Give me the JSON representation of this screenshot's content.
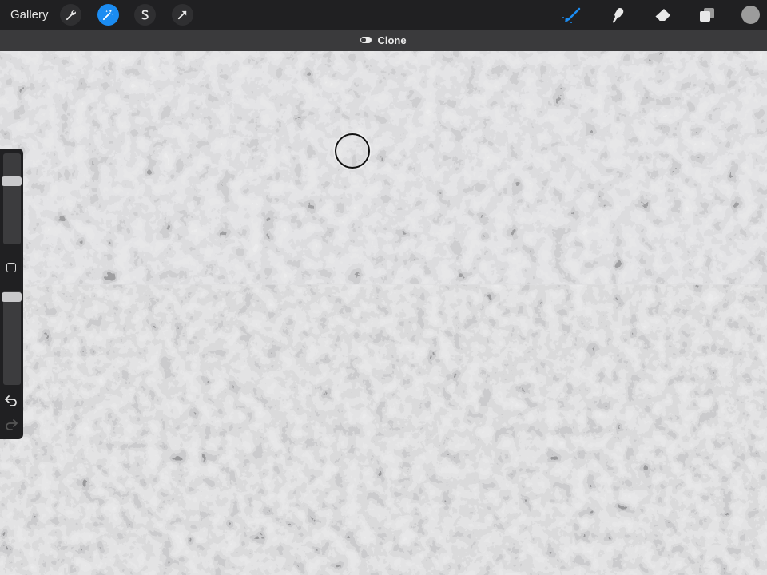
{
  "toolbar": {
    "gallery_label": "Gallery",
    "tools": [
      {
        "icon": "wrench-icon"
      },
      {
        "icon": "magic-wand-icon"
      },
      {
        "icon": "selection-icon"
      },
      {
        "icon": "transform-arrow-icon"
      }
    ],
    "active_tool": "magic-wand-icon",
    "right_tools": [
      "brush-icon",
      "smudge-icon",
      "eraser-icon",
      "layers-icon"
    ],
    "active_right_tool": "brush-icon",
    "current_color": "#9c9c9c",
    "accent_color": "#1b8cf2"
  },
  "modebar": {
    "label": "Clone"
  },
  "sidebar": {
    "brush_size_level": 0.72,
    "opacity_level": 0.98,
    "undo_icon": "undo-icon",
    "redo_icon": "redo-icon"
  },
  "canvas": {
    "texture": "granite-grayscale",
    "clone_source_icon": "clone-source-circle-icon"
  }
}
